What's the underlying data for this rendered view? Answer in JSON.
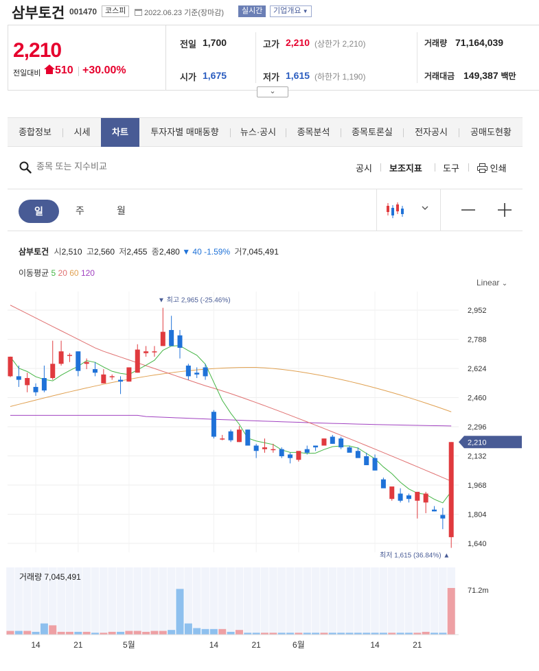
{
  "header": {
    "title": "삼부토건",
    "code": "001470",
    "market": "코스피",
    "date_text": "2022.06.23 기준(장마감)",
    "realtime": "실시간",
    "company_overview": "기업개요"
  },
  "price": {
    "current": "2,210",
    "change_label": "전일대비",
    "change": "510",
    "change_pct": "+30.00%",
    "prev_close_label": "전일",
    "prev_close": "1,700",
    "open_label": "시가",
    "open": "1,675",
    "high_label": "고가",
    "high": "2,210",
    "upper_limit": "(상한가 2,210)",
    "low_label": "저가",
    "low": "1,615",
    "lower_limit": "(하한가 1,190)",
    "volume_label": "거래량",
    "volume": "71,164,039",
    "value_label": "거래대금",
    "value": "149,387",
    "value_unit": "백만"
  },
  "tabs": [
    "종합정보",
    "시세",
    "차트",
    "투자자별 매매동향",
    "뉴스·공시",
    "종목분석",
    "종목토론실",
    "전자공시",
    "공매도현황"
  ],
  "active_tab": "차트",
  "toolbar": {
    "search_placeholder": "종목 또는 지수비교",
    "disclosure": "공시",
    "indicators": "보조지표",
    "tools": "도구",
    "print": "인쇄"
  },
  "period": {
    "day": "일",
    "week": "주",
    "month": "월"
  },
  "info": {
    "name": "삼부토건",
    "open_label": "시",
    "open": "2,510",
    "high_label": "고",
    "high": "2,560",
    "low_label": "저",
    "low": "2,455",
    "close_label": "종",
    "close": "2,480",
    "change": "▼ 40 -1.59%",
    "vol_label": "거",
    "vol": "7,045,491"
  },
  "ma": {
    "label": "이동평균",
    "p5": "5",
    "p20": "20",
    "p60": "60",
    "p120": "120"
  },
  "scale": "Linear",
  "colors": {
    "up": "#e03a3e",
    "down": "#1f72d8",
    "ma5": "#44b544",
    "ma20": "#e07070",
    "ma60": "#e0a050",
    "ma120": "#a040c0",
    "accent": "#485b95"
  },
  "chart_data": {
    "type": "candlestick",
    "y_ticks": [
      "2,952",
      "2,788",
      "2,624",
      "2,460",
      "2,296",
      "2,132",
      "1,968",
      "1,804",
      "1,640"
    ],
    "y_tick_values": [
      2952,
      2788,
      2624,
      2460,
      2296,
      2132,
      1968,
      1804,
      1640
    ],
    "x_tick_labels": [
      "14",
      "21",
      "5월",
      "14",
      "21",
      "6월",
      "14",
      "21"
    ],
    "x_tick_candle_index": [
      3,
      8,
      14,
      24,
      29,
      34,
      43,
      48
    ],
    "current_price_label": "2,210",
    "current_price_value": 2210,
    "max_marker": "▼ 최고 2,965 (-25.46%)",
    "max_value": 2965,
    "min_marker": "최저 1,615 (36.84%) ▲",
    "min_value": 1615,
    "candles": [
      [
        2580,
        2690,
        2575,
        2690
      ],
      [
        2580,
        2640,
        2520,
        2560
      ],
      [
        2530,
        2600,
        2490,
        2570
      ],
      [
        2520,
        2540,
        2470,
        2490
      ],
      [
        2570,
        2640,
        2490,
        2500
      ],
      [
        2570,
        2780,
        2560,
        2650
      ],
      [
        2650,
        2780,
        2640,
        2720
      ],
      [
        2700,
        2710,
        2660,
        2700
      ],
      [
        2720,
        2720,
        2580,
        2610
      ],
      [
        2650,
        2680,
        2620,
        2660
      ],
      [
        2620,
        2660,
        2580,
        2600
      ],
      [
        2540,
        2620,
        2540,
        2590
      ],
      [
        2580,
        2590,
        2560,
        2580
      ],
      [
        2560,
        2580,
        2480,
        2550
      ],
      [
        2550,
        2630,
        2550,
        2630
      ],
      [
        2600,
        2760,
        2600,
        2730
      ],
      [
        2710,
        2750,
        2690,
        2720
      ],
      [
        2720,
        2750,
        2690,
        2720
      ],
      [
        2750,
        2965,
        2750,
        2830
      ],
      [
        2840,
        2920,
        2770,
        2750
      ],
      [
        2810,
        2840,
        2680,
        2740
      ],
      [
        2640,
        2650,
        2560,
        2580
      ],
      [
        2600,
        2630,
        2570,
        2590
      ],
      [
        2630,
        2650,
        2560,
        2580
      ],
      [
        2380,
        2390,
        2230,
        2240
      ],
      [
        2230,
        2250,
        2220,
        2230
      ],
      [
        2270,
        2280,
        2210,
        2220
      ],
      [
        2210,
        2300,
        2210,
        2280
      ],
      [
        2280,
        2280,
        2200,
        2190
      ],
      [
        2190,
        2200,
        2120,
        2160
      ],
      [
        2170,
        2230,
        2150,
        2180
      ],
      [
        2170,
        2200,
        2150,
        2170
      ],
      [
        2170,
        2180,
        2120,
        2130
      ],
      [
        2140,
        2150,
        2090,
        2120
      ],
      [
        2110,
        2140,
        2100,
        2160
      ],
      [
        2170,
        2190,
        2140,
        2150
      ],
      [
        2190,
        2190,
        2160,
        2180
      ],
      [
        2190,
        2230,
        2190,
        2230
      ],
      [
        2240,
        2250,
        2200,
        2200
      ],
      [
        2230,
        2240,
        2170,
        2180
      ],
      [
        2180,
        2190,
        2160,
        2150
      ],
      [
        2160,
        2180,
        2140,
        2120
      ],
      [
        2130,
        2150,
        2080,
        2080
      ],
      [
        2120,
        2140,
        2050,
        2050
      ],
      [
        2000,
        2010,
        1970,
        1950
      ],
      [
        1890,
        1950,
        1880,
        1960
      ],
      [
        1920,
        1950,
        1870,
        1880
      ],
      [
        1910,
        1920,
        1870,
        1890
      ],
      [
        1880,
        1920,
        1780,
        1930
      ],
      [
        1870,
        1930,
        1810,
        1920
      ],
      [
        1830,
        1850,
        1820,
        1820
      ],
      [
        1800,
        1840,
        1720,
        1780
      ],
      [
        1675,
        2210,
        1615,
        2210
      ]
    ],
    "volume_label": "거래량 7,045,491",
    "volume_axis_label": "71.2m",
    "volumes": [
      4,
      4,
      4,
      3,
      12,
      10,
      3,
      3,
      3,
      3,
      2,
      2,
      3,
      3,
      4,
      4,
      3,
      4,
      4,
      5,
      49,
      12,
      7,
      6,
      6,
      6,
      3,
      5,
      2,
      2,
      2,
      2,
      2,
      2,
      2,
      2,
      2,
      2,
      2,
      2,
      2,
      2,
      2,
      2,
      2,
      2,
      2,
      2,
      2,
      3,
      2,
      2,
      50
    ]
  }
}
